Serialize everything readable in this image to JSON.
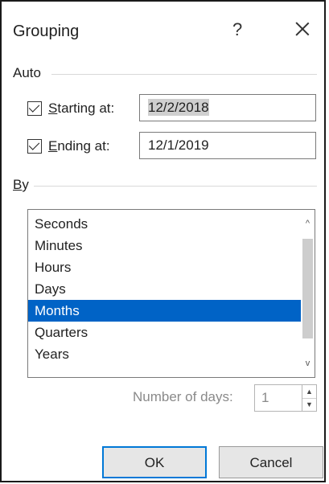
{
  "window": {
    "title": "Grouping",
    "help_glyph": "?",
    "close_icon": "close-icon"
  },
  "auto": {
    "label": "Auto",
    "starting": {
      "checked": true,
      "label_first": "S",
      "label_rest": "tarting at:",
      "value": "12/2/2018"
    },
    "ending": {
      "checked": true,
      "label_first": "E",
      "label_rest": "nding at:",
      "value": "12/1/2019"
    }
  },
  "by": {
    "label_first": "B",
    "label_rest": "y",
    "items": [
      {
        "label": "Seconds",
        "selected": false
      },
      {
        "label": "Minutes",
        "selected": false
      },
      {
        "label": "Hours",
        "selected": false
      },
      {
        "label": "Days",
        "selected": false
      },
      {
        "label": "Months",
        "selected": true
      },
      {
        "label": "Quarters",
        "selected": false
      },
      {
        "label": "Years",
        "selected": false
      }
    ],
    "scroll_up_glyph": "^",
    "scroll_down_glyph": "v"
  },
  "days": {
    "label": "Number of days:",
    "value": "1",
    "enabled": false
  },
  "buttons": {
    "ok": "OK",
    "cancel": "Cancel"
  },
  "colors": {
    "selection": "#0063c6",
    "default_button_border": "#0078d7"
  }
}
